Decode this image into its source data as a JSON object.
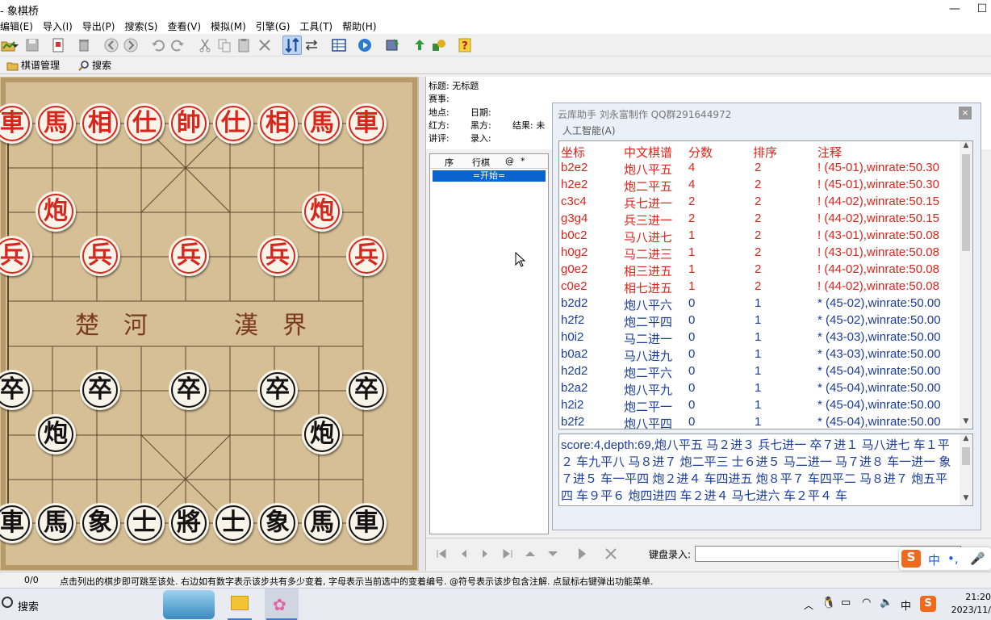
{
  "window": {
    "title": "- 象棋桥"
  },
  "menu": [
    "编辑(E)",
    "导入(I)",
    "导出(P)",
    "搜索(S)",
    "查看(V)",
    "模拟(M)",
    "引擎(G)",
    "工具(T)",
    "帮助(H)"
  ],
  "tabs": [
    {
      "label": "棋谱管理"
    },
    {
      "label": "搜索"
    }
  ],
  "board": {
    "river_left": "楚　河",
    "river_right": "漢　界",
    "red_back_row": [
      "車",
      "馬",
      "相",
      "仕",
      "帥",
      "仕",
      "相",
      "馬",
      "車"
    ],
    "red_cannon": "炮",
    "red_pawn": "兵",
    "black_back_row": [
      "車",
      "馬",
      "象",
      "士",
      "將",
      "士",
      "象",
      "馬",
      "車"
    ],
    "black_cannon": "炮",
    "black_pawn": "卒"
  },
  "info": {
    "title_label": "标题: 无标题",
    "event_label": "赛事:",
    "place_label": "地点:",
    "date_label": "日期:",
    "red_label": "红方:",
    "black_label": "黑方:",
    "result_label": "结果: 未",
    "commentary_label": "讲评:",
    "recorder_label": "录入:"
  },
  "movelist": {
    "col_seq": "序",
    "col_move": "行棋",
    "col_at": "@",
    "col_star": "*",
    "selected": "=开始="
  },
  "cloud": {
    "title": "云库助手 刘永富制作 QQ群291644972",
    "close": "×",
    "menu": "人工智能(A)",
    "headers": {
      "coord": "坐标",
      "notation": "中文棋谱",
      "score": "分数",
      "rank": "排序",
      "note": "注释"
    },
    "rows": [
      {
        "coord": "b2e2",
        "notation": "炮八平五",
        "score": "4",
        "rank": "2",
        "note": "! (45-01),winrate:50.30",
        "color": "red"
      },
      {
        "coord": "h2e2",
        "notation": "炮二平五",
        "score": "4",
        "rank": "2",
        "note": "! (45-01),winrate:50.30",
        "color": "red"
      },
      {
        "coord": "c3c4",
        "notation": "兵七进一",
        "score": "2",
        "rank": "2",
        "note": "! (44-02),winrate:50.15",
        "color": "red"
      },
      {
        "coord": "g3g4",
        "notation": "兵三进一",
        "score": "2",
        "rank": "2",
        "note": "! (44-02),winrate:50.15",
        "color": "red"
      },
      {
        "coord": "b0c2",
        "notation": "马八进七",
        "score": "1",
        "rank": "2",
        "note": "! (43-01),winrate:50.08",
        "color": "red"
      },
      {
        "coord": "h0g2",
        "notation": "马二进三",
        "score": "1",
        "rank": "2",
        "note": "! (43-01),winrate:50.08",
        "color": "red"
      },
      {
        "coord": "g0e2",
        "notation": "相三进五",
        "score": "1",
        "rank": "2",
        "note": "! (44-02),winrate:50.08",
        "color": "red"
      },
      {
        "coord": "c0e2",
        "notation": "相七进五",
        "score": "1",
        "rank": "2",
        "note": "! (44-02),winrate:50.08",
        "color": "red"
      },
      {
        "coord": "b2d2",
        "notation": "炮八平六",
        "score": "0",
        "rank": "1",
        "note": "* (45-02),winrate:50.00",
        "color": "blue"
      },
      {
        "coord": "h2f2",
        "notation": "炮二平四",
        "score": "0",
        "rank": "1",
        "note": "* (45-02),winrate:50.00",
        "color": "blue"
      },
      {
        "coord": "h0i2",
        "notation": "马二进一",
        "score": "0",
        "rank": "1",
        "note": "* (43-03),winrate:50.00",
        "color": "blue"
      },
      {
        "coord": "b0a2",
        "notation": "马八进九",
        "score": "0",
        "rank": "1",
        "note": "* (43-03),winrate:50.00",
        "color": "blue"
      },
      {
        "coord": "h2d2",
        "notation": "炮二平六",
        "score": "0",
        "rank": "1",
        "note": "* (45-04),winrate:50.00",
        "color": "blue"
      },
      {
        "coord": "b2a2",
        "notation": "炮八平九",
        "score": "0",
        "rank": "1",
        "note": "* (45-04),winrate:50.00",
        "color": "blue"
      },
      {
        "coord": "h2i2",
        "notation": "炮二平一",
        "score": "0",
        "rank": "1",
        "note": "* (45-04),winrate:50.00",
        "color": "blue"
      },
      {
        "coord": "b2f2",
        "notation": "炮八平四",
        "score": "0",
        "rank": "1",
        "note": "* (45-04),winrate:50.00",
        "color": "blue"
      }
    ],
    "analysis": "score:4,depth:69,炮八平五 马２进３ 兵七进一 卒７进１ 马八进七 车１平２ 车九平八 马８进７ 炮二平三 士６进５ 马二进一 马７进８ 车一进一 象７进５ 车一平四 炮２进４ 车四进五 炮８平７ 车四平二 马８进７ 炮五平四 车９平６ 炮四进四 车２进４ 马七进六 车２平４ 车"
  },
  "nav": {
    "keyboard_label": "键盘录入:",
    "keyboard_value": ""
  },
  "status": {
    "count": "0/0",
    "message": "点击列出的棋步即可跳至该处. 右边如有数字表示该步共有多少变着, 字母表示当前选中的变着编号. @符号表示该步包含注解. 点鼠标右键弹出功能菜单."
  },
  "ime": {
    "zh": "中",
    "punct": "•,"
  },
  "taskbar": {
    "search": "搜索",
    "ime_zh": "中",
    "time": "21:20",
    "date": "2023/11/"
  },
  "colors": {
    "red_piece": "#d8261c",
    "black_piece": "#111111",
    "selection": "#0a64d0",
    "note_blue": "#1a3c9a"
  }
}
